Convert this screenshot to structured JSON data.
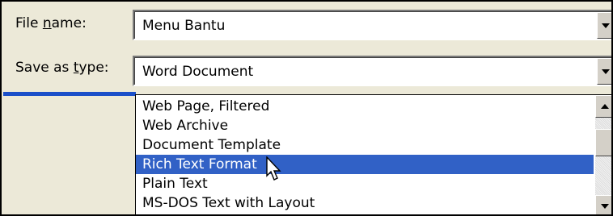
{
  "file_name": {
    "label_before": "File ",
    "label_accel": "n",
    "label_after": "ame:",
    "value": "Menu Bantu"
  },
  "save_as_type": {
    "label_before": "Save as ",
    "label_accel": "t",
    "label_after": "ype:",
    "value": "Word Document"
  },
  "type_options": [
    "Web Page, Filtered",
    "Web Archive",
    "Document Template",
    "Rich Text Format",
    "Plain Text",
    "MS-DOS Text with Layout"
  ],
  "selected_option": "Rich Text Format",
  "icons": {
    "dropdown": "chevron-down-icon",
    "scroll_up": "scroll-up-icon",
    "scroll_down": "scroll-down-icon",
    "cursor": "mouse-pointer-icon"
  },
  "colors": {
    "selection": "#3161c6",
    "accent_line": "#1a4fc9"
  }
}
